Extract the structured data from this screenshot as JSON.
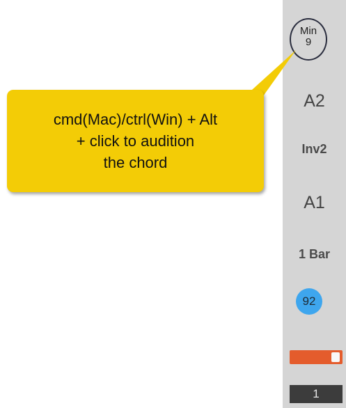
{
  "chord": {
    "quality": "Min",
    "number": "9"
  },
  "strip": {
    "octave": "A2",
    "inversion": "Inv2",
    "note": "A1",
    "length": "1 Bar",
    "tempo": "92",
    "counter": "1"
  },
  "slider": {
    "level_fraction": 0.82
  },
  "callout": {
    "text": "cmd(Mac)/ctrl(Win) + Alt\n+ click to audition\nthe chord"
  },
  "colors": {
    "callout_bg": "#f3cc06",
    "tempo_badge": "#3ea6ee",
    "slider_fill": "#e45c2c",
    "strip_bg": "#d5d5d5"
  }
}
